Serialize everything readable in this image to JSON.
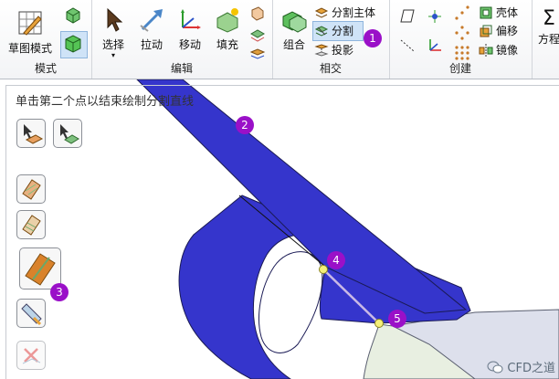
{
  "ribbon": {
    "groups": {
      "mode": {
        "label": "模式",
        "sketch_mode": "草图模式"
      },
      "edit": {
        "label": "编辑",
        "select": "选择",
        "pull": "拉动",
        "move": "移动",
        "fill": "填充"
      },
      "intersect": {
        "label": "相交",
        "combine": "组合",
        "split_body": "分割主体",
        "split": "分割",
        "project": "投影"
      },
      "create": {
        "label": "创建",
        "shell": "壳体",
        "offset": "偏移",
        "mirror": "镜像"
      },
      "equation": {
        "label": "方程"
      }
    }
  },
  "canvas": {
    "hint": "单击第二个点以结束绘制分割直线",
    "badges": [
      "1",
      "2",
      "3",
      "4",
      "5"
    ],
    "watermark": "CFD之道"
  },
  "colors": {
    "body_blue": "#3535cc",
    "badge_purple": "#9a10c8",
    "split_line": "#c9b9e6",
    "point_yellow": "#f4ef7a"
  }
}
